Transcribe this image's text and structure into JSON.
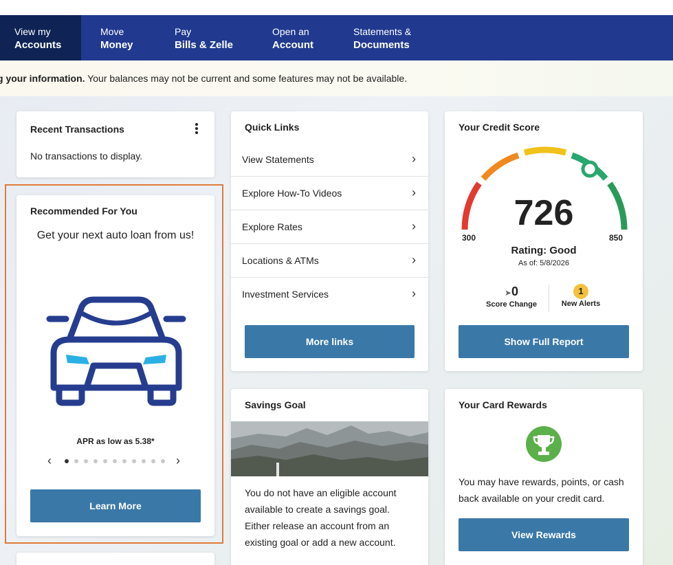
{
  "nav": {
    "items": [
      {
        "line1": "View my",
        "line2": "Accounts",
        "active": true
      },
      {
        "line1": "Move",
        "line2": "Money"
      },
      {
        "line1": "Pay",
        "line2": "Bills & Zelle"
      },
      {
        "line1": "Open an",
        "line2": "Account"
      },
      {
        "line1": "Statements &",
        "line2": "Documents"
      }
    ]
  },
  "notice": {
    "bold": "g your information.",
    "text": " Your balances may not be current and some features may not be available."
  },
  "recent_transactions": {
    "title": "Recent Transactions",
    "empty": "No transactions to display."
  },
  "recommended": {
    "title": "Recommended For You",
    "headline": "Get your next auto loan from us!",
    "apr": "APR as low as 5.38*",
    "button": "Learn More",
    "slides_total": 11,
    "slide_active": 1
  },
  "quick_links": {
    "title": "Quick Links",
    "items": [
      {
        "label": "View Statements"
      },
      {
        "label": "Explore How-To Videos"
      },
      {
        "label": "Explore Rates"
      },
      {
        "label": "Locations & ATMs"
      },
      {
        "label": "Investment Services"
      }
    ],
    "button": "More links"
  },
  "credit_score": {
    "title": "Your Credit Score",
    "score": "726",
    "min": "300",
    "max": "850",
    "rating": "Rating: Good",
    "as_of": "As of: 5/8/2026",
    "score_change_value": "0",
    "score_change_label": "Score Change",
    "alerts_value": "1",
    "alerts_label": "New Alerts",
    "button": "Show Full Report"
  },
  "savings_goal": {
    "title": "Savings Goal",
    "text": "You do not have an eligible account available to create a savings goal. Either release an account from an existing goal or add a new account."
  },
  "card_rewards": {
    "title": "Your Card Rewards",
    "text": "You may have rewards, points, or cash back available on your credit card.",
    "button": "View Rewards"
  },
  "colors": {
    "nav_bg": "#213a8f",
    "nav_active": "#0f2355",
    "button": "#3a78a8",
    "highlight_border": "#e07b39",
    "trophy": "#5bb04a"
  }
}
